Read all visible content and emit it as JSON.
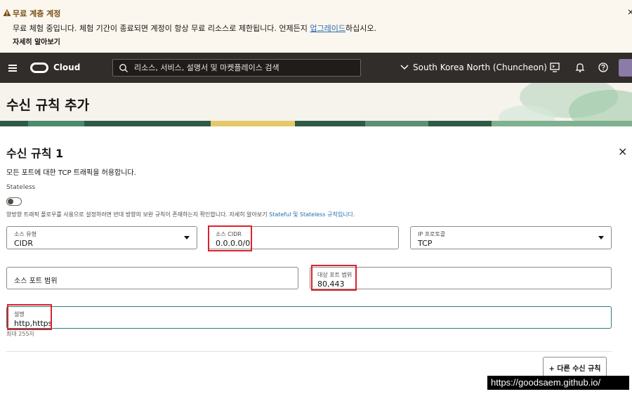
{
  "banner": {
    "title": "무료 계층 계정",
    "message_prefix": "무료 체험 중입니다. 체험 기간이 종료되면 계정이 항상 무료 리소스로 제한됩니다. 언제든지 ",
    "upgrade_link": "업그레이드",
    "message_suffix": "하십시오.",
    "learn_more": "자세히 알아보기",
    "close": "×"
  },
  "header": {
    "logo_text": "Cloud",
    "search_placeholder": "리소스, 서비스, 설명서 및 마켓플레이스 검색",
    "region": "South Korea North (Chuncheon)"
  },
  "page": {
    "title": "수신 규칙 추가"
  },
  "rule": {
    "title": "수신 규칙 1",
    "close": "×",
    "description": "모든 포트에 대한 TCP 트래픽을 허용합니다.",
    "stateless_label": "Stateless",
    "help_prefix": "양방향 트래픽 플로우를 사용으로 설정하려면 반대 방향의 보완 규칙이 존재하는지 확인합니다. 자세히 알아보기 ",
    "help_link": "Stateful 및 Stateless 규칙입니다.",
    "source_type": {
      "label": "소스 유형",
      "value": "CIDR"
    },
    "source_cidr": {
      "label": "소스 CIDR",
      "value": "0.0.0.0/0"
    },
    "ip_protocol": {
      "label": "IP 프로토콜",
      "value": "TCP"
    },
    "source_port": {
      "placeholder": "소스 포트 범위"
    },
    "dest_port": {
      "label": "대상 포트 범위",
      "value": "80,443"
    },
    "description_field": {
      "label": "설명",
      "value": "http,https"
    },
    "max_chars": "최대 255자",
    "add_button": "+ 다른 수신 규칙"
  },
  "watermark": "https://goodsaem.github.io/",
  "colors": {
    "header_bg": "#312d2a",
    "banner_bg": "#fbf6ee",
    "highlight": "#d9232e",
    "focus": "#2e7d7a"
  }
}
